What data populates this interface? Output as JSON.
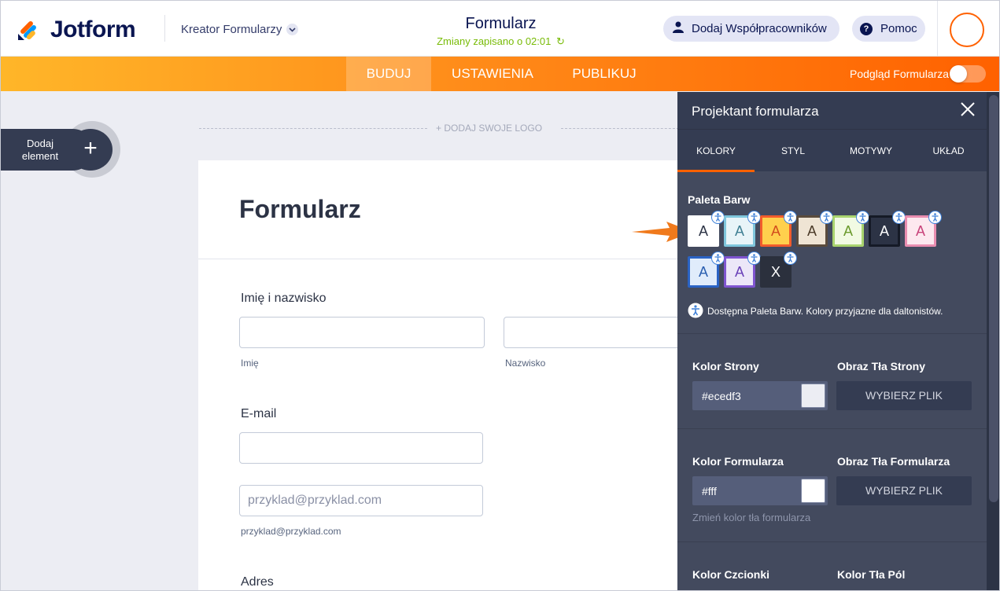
{
  "header": {
    "brand": "Jotform",
    "builder_dropdown": "Kreator Formularzy",
    "form_title": "Formularz",
    "save_status": "Zmiany zapisano o 02:01",
    "add_collaborators": "Dodaj Współpracowników",
    "help": "Pomoc"
  },
  "nav": {
    "tabs": [
      "BUDUJ",
      "USTAWIENIA",
      "PUBLIKUJ"
    ],
    "active_tab": "BUDUJ",
    "preview_label": "Podgląd Formularza",
    "preview_on": false
  },
  "canvas": {
    "add_element_label": "Dodaj element",
    "add_logo": "+ DODAJ SWOJE LOGO",
    "page_color": "#ecedf3"
  },
  "form": {
    "heading": "Formularz",
    "name_label": "Imię i nazwisko",
    "first_name_sub": "Imię",
    "last_name_sub": "Nazwisko",
    "email_label": "E-mail",
    "email_placeholder": "przyklad@przyklad.com",
    "email_sub": "przyklad@przyklad.com",
    "address_label": "Adres"
  },
  "designer": {
    "title": "Projektant formularza",
    "tabs": [
      "KOLORY",
      "STYL",
      "MOTYWY",
      "UKŁAD"
    ],
    "active_tab": "KOLORY",
    "palette_title": "Paleta Barw",
    "palette": [
      {
        "letter": "A",
        "bg": "#ffffff",
        "fg": "#2c3345",
        "border": "#ffffff",
        "accessible": true
      },
      {
        "letter": "A",
        "bg": "#e8f4f8",
        "fg": "#3f7f93",
        "border": "#7fc6dc",
        "accessible": true
      },
      {
        "letter": "A",
        "bg": "#ffd04d",
        "fg": "#d24d1c",
        "border": "#f25c2c",
        "accessible": true
      },
      {
        "letter": "A",
        "bg": "#efe4d4",
        "fg": "#4b3a28",
        "border": "#5a4b3c",
        "accessible": true
      },
      {
        "letter": "A",
        "bg": "#f1fae3",
        "fg": "#6a9a2c",
        "border": "#a9d46f",
        "accessible": true
      },
      {
        "letter": "A",
        "bg": "#2c3345",
        "fg": "#ffffff",
        "border": "#151a26",
        "accessible": true
      },
      {
        "letter": "A",
        "bg": "#fde8ef",
        "fg": "#c8427a",
        "border": "#e98db0",
        "accessible": true
      },
      {
        "letter": "A",
        "bg": "#e0ecfb",
        "fg": "#2a5fb0",
        "border": "#2a63c4",
        "accessible": true
      },
      {
        "letter": "A",
        "bg": "#ece7f8",
        "fg": "#6a41b8",
        "border": "#7f55d0",
        "accessible": true
      },
      {
        "letter": "X",
        "bg": "#2b303d",
        "fg": "#ffffff",
        "border": "#2b303d",
        "accessible": true
      }
    ],
    "palette_note": "Dostępna Paleta Barw. Kolory przyjazne dla daltonistów.",
    "page_color_label": "Kolor Strony",
    "page_color_value": "#ecedf3",
    "page_bg_image_label": "Obraz Tła Strony",
    "choose_file": "WYBIERZ PLIK",
    "form_color_label": "Kolor Formularza",
    "form_color_value": "#fff",
    "form_bg_image_label": "Obraz Tła Formularza",
    "form_color_hint": "Zmień kolor tła formularza",
    "font_color_label": "Kolor Czcionki",
    "field_bg_label": "Kolor Tła Pól"
  },
  "colors": {
    "brand_orange": "#ff6100",
    "brand_navy": "#0a1551",
    "saved_green": "#78bb07",
    "panel_bg": "#434a5e"
  }
}
